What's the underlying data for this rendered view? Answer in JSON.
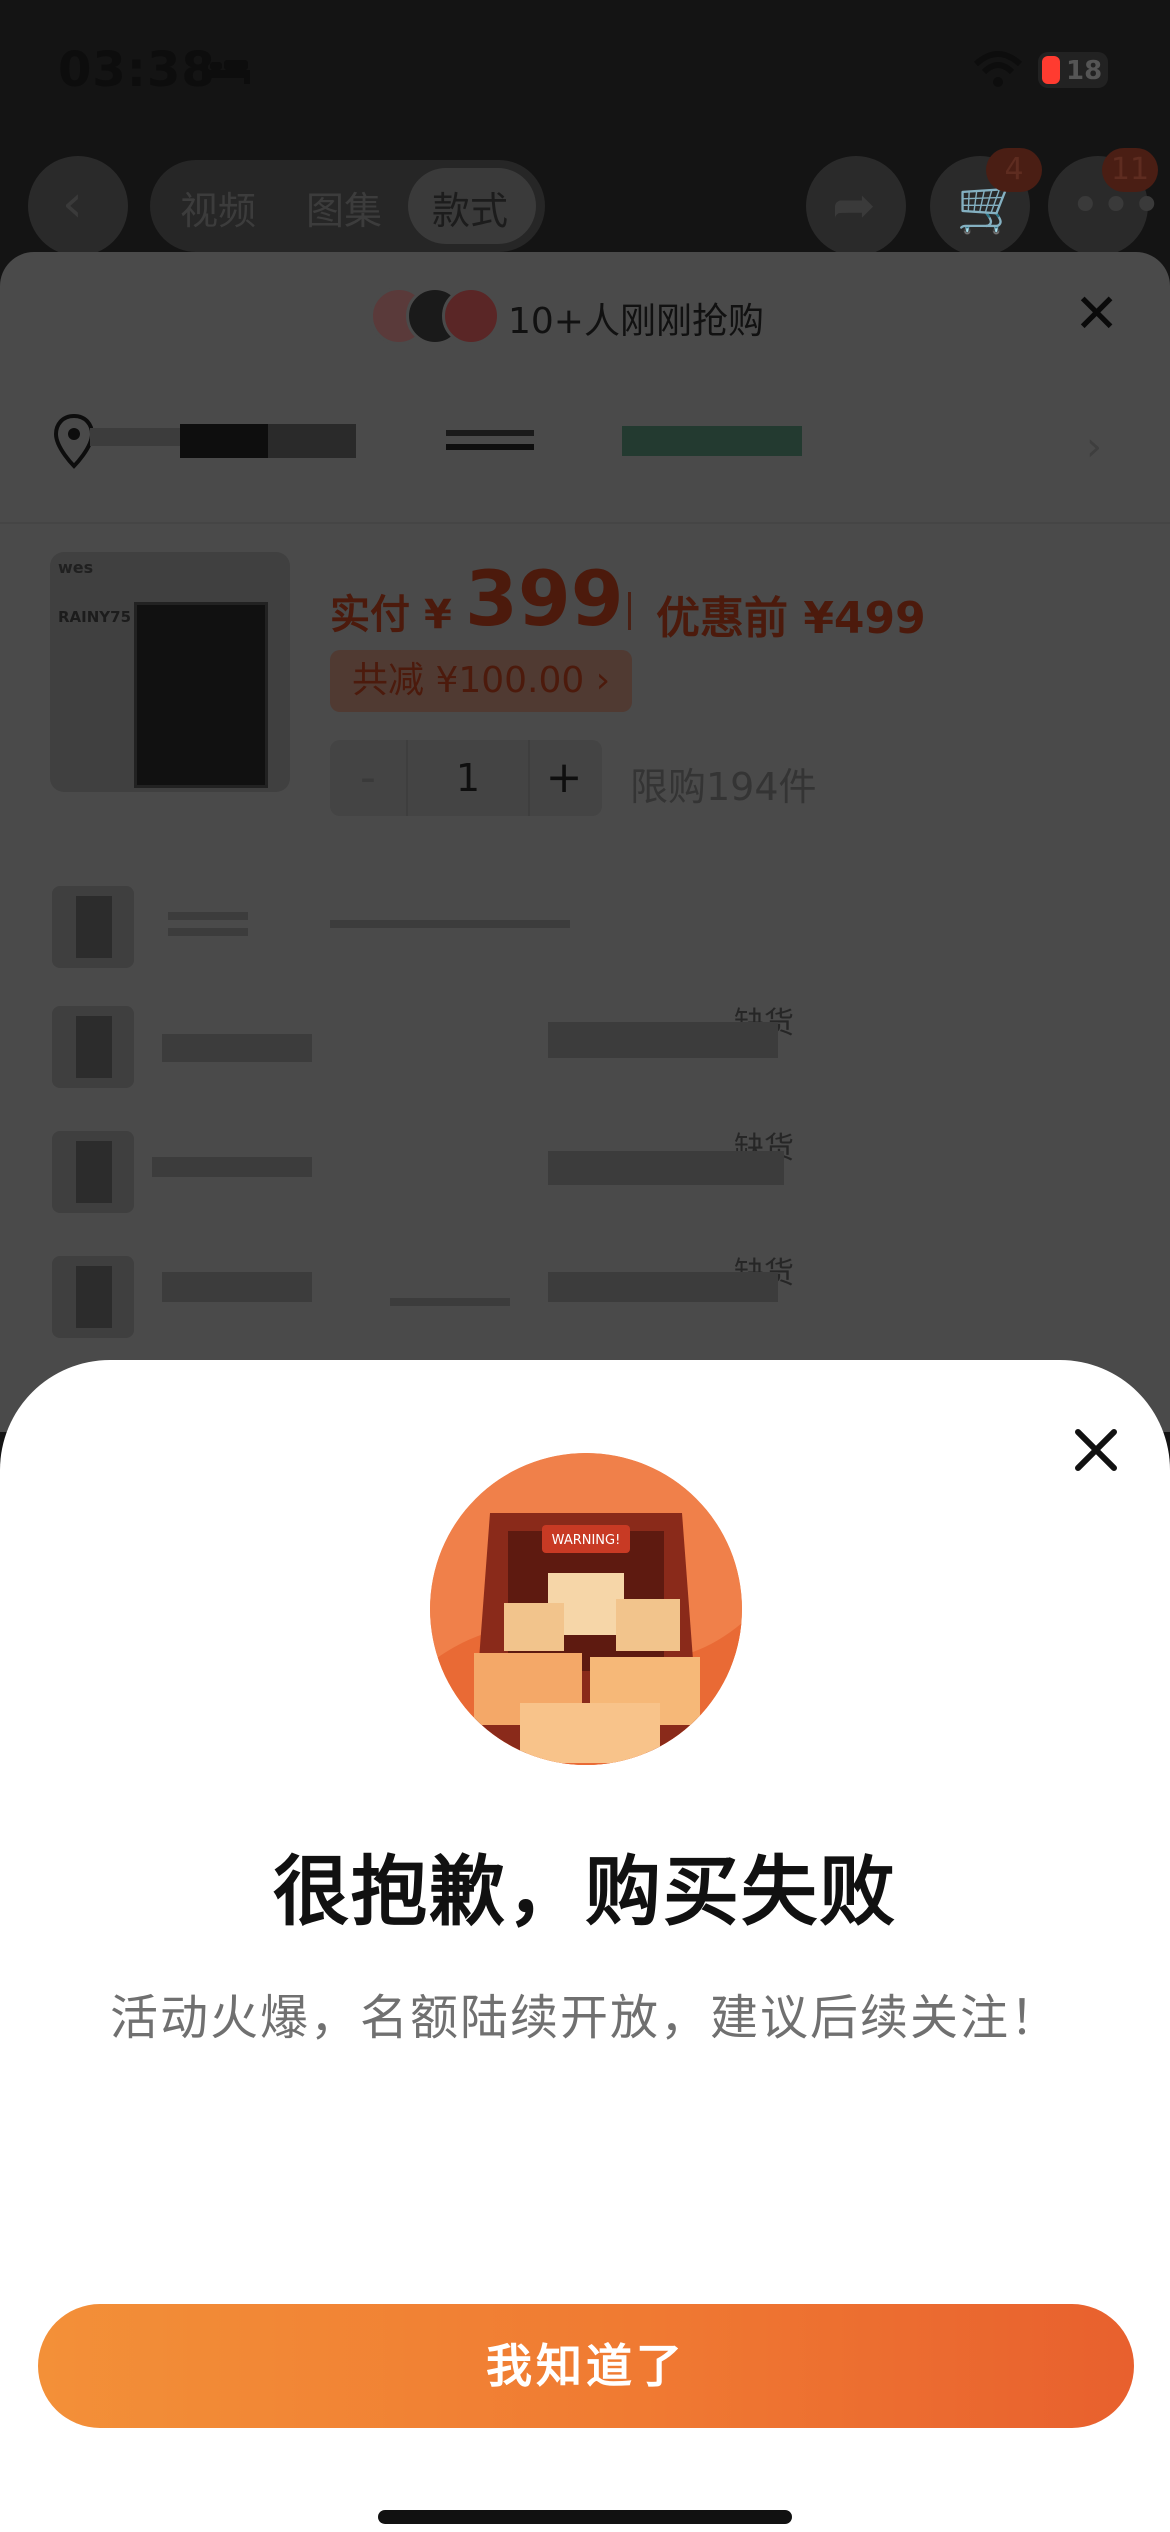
{
  "status_bar": {
    "time": "03:38",
    "battery_level": "18",
    "icons": [
      "bed-icon",
      "wifi-icon",
      "battery-icon"
    ]
  },
  "top_nav": {
    "tabs": [
      {
        "label": "视频",
        "active": false
      },
      {
        "label": "图集",
        "active": false
      },
      {
        "label": "款式",
        "active": true
      }
    ],
    "cart_badge": "4",
    "more_badge": "11"
  },
  "sheet": {
    "title": "10+人刚刚抢购",
    "product": {
      "brand": "wes",
      "model": "RAINY75",
      "price_prefix": "实付",
      "currency": "¥",
      "price": "399",
      "original_price_label": "优惠前 ¥499",
      "discount_label": "共减 ¥100.00 ›",
      "quantity": "1",
      "minus": "-",
      "plus": "+",
      "limit_label": "限购194件"
    },
    "variants": [
      {
        "status": ""
      },
      {
        "status": "缺货"
      },
      {
        "status": "缺货"
      },
      {
        "status": "缺货"
      }
    ]
  },
  "modal": {
    "illustration_label": "WARNING!",
    "title": "很抱歉，购买失败",
    "message": "活动火爆，名额陆续开放，建议后续关注！",
    "confirm_label": "我知道了"
  },
  "colors": {
    "accent": "#f07a32",
    "accent_end": "#e8602e",
    "price_red": "#e8511c"
  }
}
